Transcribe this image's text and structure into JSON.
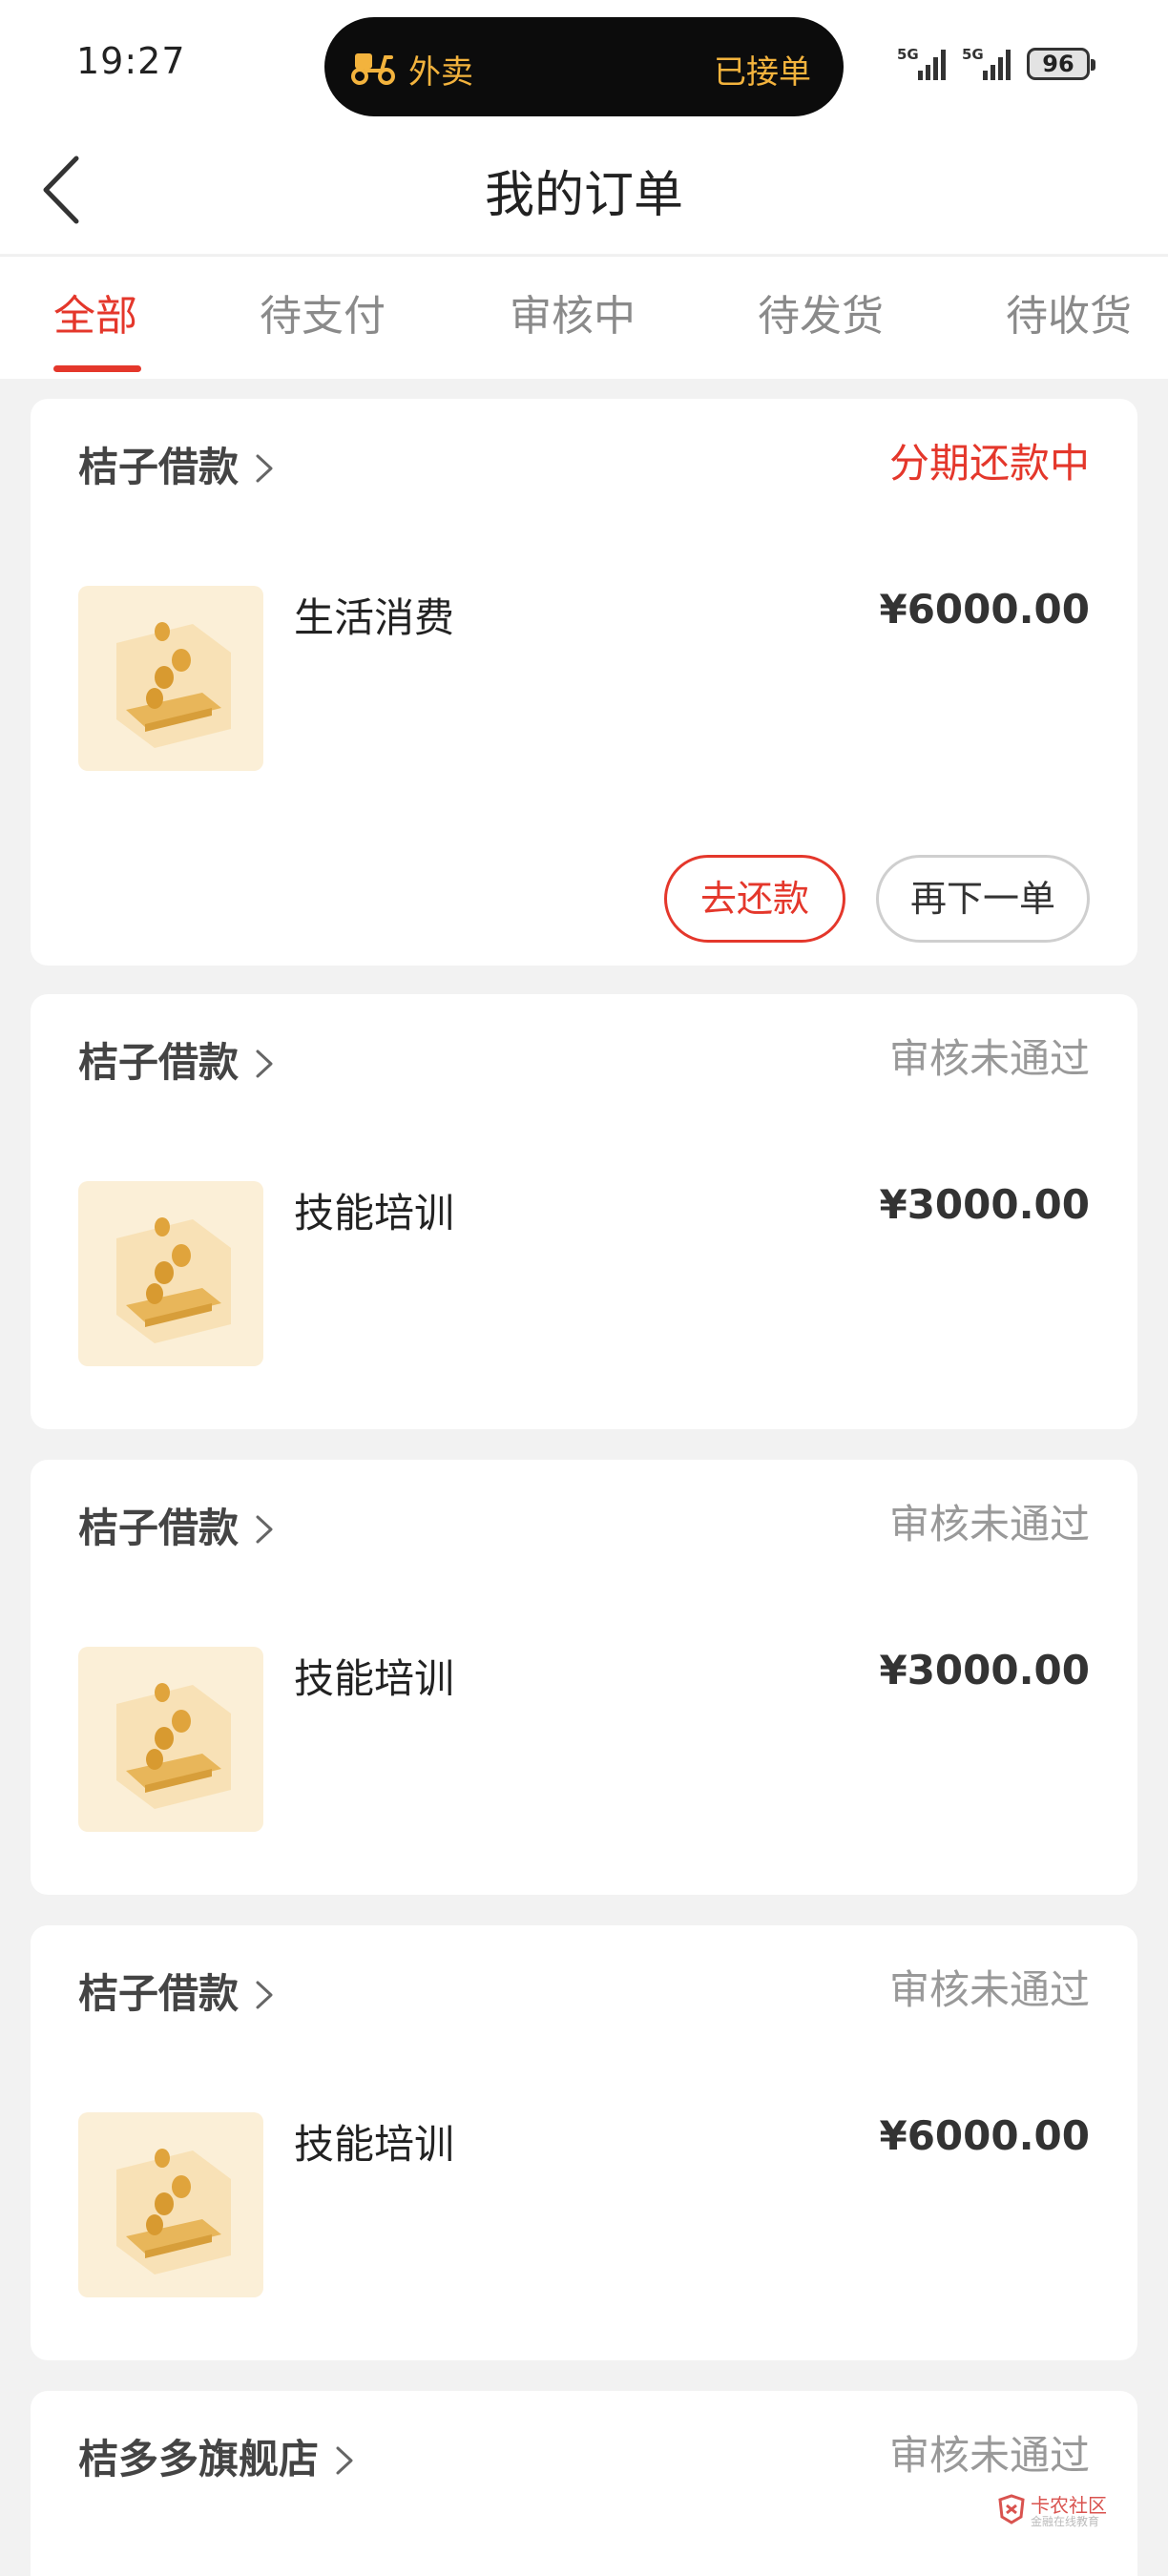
{
  "status_bar": {
    "time": "19:27",
    "island_left": "外卖",
    "island_right": "已接单",
    "network1": "5G",
    "network2": "5G",
    "battery": "96"
  },
  "nav": {
    "title": "我的订单",
    "back_icon": "chevron-left-icon"
  },
  "tabs": [
    "全部",
    "待支付",
    "审核中",
    "待发货",
    "待收货"
  ],
  "active_tab": "全部",
  "orders": [
    {
      "merchant": "桔子借款",
      "status": "分期还款中",
      "product": "生活消费",
      "price": "¥6000.00",
      "actions": [
        "去还款",
        "再下一单"
      ]
    },
    {
      "merchant": "桔子借款",
      "status": "审核未通过",
      "product": "技能培训",
      "price": "¥3000.00"
    },
    {
      "merchant": "桔子借款",
      "status": "审核未通过",
      "product": "技能培训",
      "price": "¥3000.00"
    },
    {
      "merchant": "桔子借款",
      "status": "审核未通过",
      "product": "技能培训",
      "price": "¥6000.00"
    },
    {
      "merchant": "桔多多旗舰店",
      "status": "审核未通过"
    }
  ],
  "watermark": {
    "line1": "卡农社区",
    "line2": "金融在线教育"
  },
  "colors": {
    "accent": "#e4372b",
    "island_text": "#f3b33d",
    "muted": "#999999"
  }
}
